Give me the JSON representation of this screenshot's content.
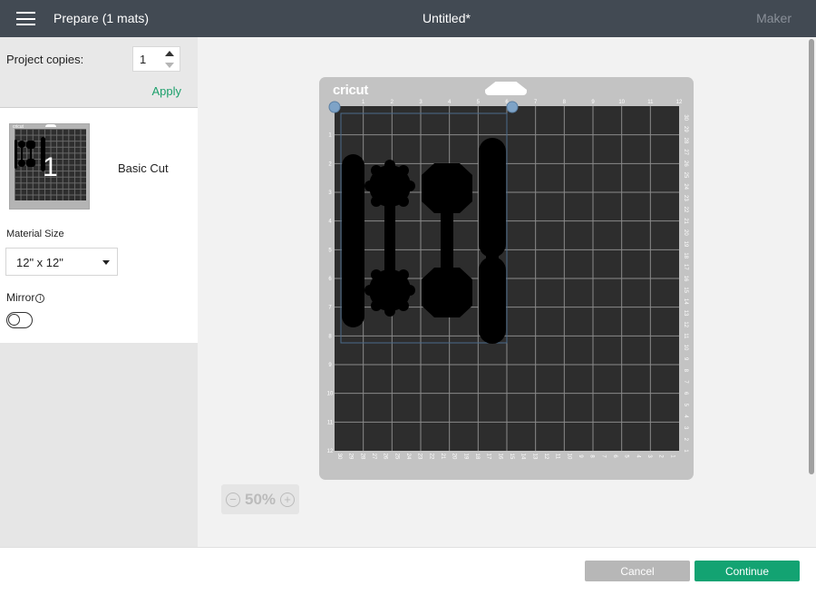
{
  "header": {
    "title": "Prepare (1 mats)",
    "document_title": "Untitled*",
    "machine": "Maker"
  },
  "left_panel": {
    "project_copies_label": "Project copies:",
    "project_copies_value": "1",
    "apply_label": "Apply",
    "mat": {
      "number": "1",
      "label": "Basic Cut",
      "thumb_logo": "cricut"
    },
    "material_size_label": "Material Size",
    "material_size_value": "12\" x 12\"",
    "mirror_label": "Mirror",
    "mirror_on": false
  },
  "mat_preview": {
    "logo": "cricut",
    "top_ruler": [
      "1",
      "2",
      "3",
      "4",
      "5",
      "6",
      "7",
      "8",
      "9",
      "10",
      "11",
      "12"
    ],
    "left_ruler": [
      "1",
      "2",
      "3",
      "4",
      "5",
      "6",
      "7",
      "8",
      "9",
      "10",
      "11",
      "12"
    ],
    "right_ruler": [
      "30",
      "29",
      "28",
      "27",
      "26",
      "25",
      "24",
      "23",
      "22",
      "21",
      "20",
      "19",
      "18",
      "17",
      "16",
      "15",
      "14",
      "13",
      "12",
      "11",
      "10",
      "9",
      "8",
      "7",
      "6",
      "5",
      "4",
      "3",
      "2",
      "1"
    ],
    "bottom_ruler": [
      "30",
      "29",
      "28",
      "27",
      "26",
      "25",
      "24",
      "23",
      "22",
      "21",
      "20",
      "19",
      "18",
      "17",
      "16",
      "15",
      "14",
      "13",
      "12",
      "11",
      "10",
      "9",
      "8",
      "7",
      "6",
      "5",
      "4",
      "3",
      "2",
      "1"
    ]
  },
  "zoom": {
    "level": "50%",
    "minus": "−",
    "plus": "+"
  },
  "footer": {
    "cancel_label": "Cancel",
    "continue_label": "Continue"
  },
  "colors": {
    "topbar": "#424a53",
    "accent": "#13a372",
    "mat_grid": "#2d2d2d"
  }
}
